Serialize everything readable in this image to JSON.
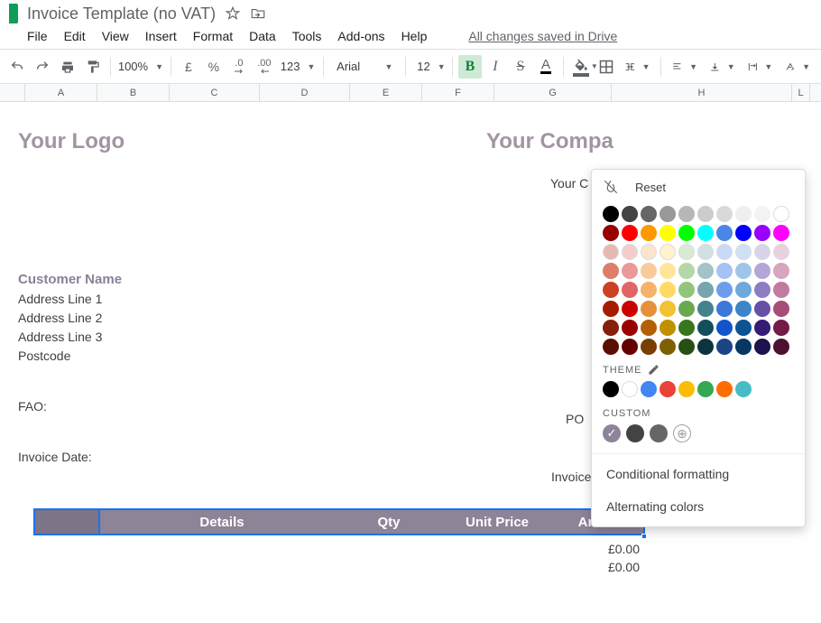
{
  "title": "Invoice Template (no VAT)",
  "menus": [
    "File",
    "Edit",
    "View",
    "Insert",
    "Format",
    "Data",
    "Tools",
    "Add-ons",
    "Help"
  ],
  "save_status": "All changes saved in Drive",
  "toolbar": {
    "zoom": "100%",
    "currency": "£",
    "percent": "%",
    "dec_decrease": ".0",
    "dec_increase": ".00",
    "more_formats": "123",
    "font": "Arial",
    "font_size": "12",
    "bold": "B",
    "italic": "I",
    "strike": "S",
    "text_color": "A"
  },
  "columns": [
    "",
    "A",
    "B",
    "C",
    "D",
    "E",
    "F",
    "G",
    "H",
    "L"
  ],
  "sheet": {
    "logo": "Your Logo",
    "company": "Your Compa",
    "your_c": "Your C",
    "customer": "Customer Name",
    "addr": [
      "Address Line 1",
      "Address Line 2",
      "Address Line 3",
      "Postcode"
    ],
    "fao": "FAO:",
    "po": "PO",
    "invoice_date": "Invoice Date:",
    "invoice_number": "Invoice Number:",
    "headers": [
      "",
      "Details",
      "Qty",
      "Unit Price",
      "Amount"
    ],
    "amounts": [
      "£0.00",
      "£0.00"
    ]
  },
  "picker": {
    "reset": "Reset",
    "theme_label": "THEME",
    "custom_label": "CUSTOM",
    "conditional": "Conditional formatting",
    "alternating": "Alternating colors",
    "standard_colors": [
      [
        "#000000",
        "#434343",
        "#666666",
        "#999999",
        "#b7b7b7",
        "#cccccc",
        "#d9d9d9",
        "#efefef",
        "#f3f3f3",
        "#ffffff"
      ],
      [
        "#980000",
        "#ff0000",
        "#ff9900",
        "#ffff00",
        "#00ff00",
        "#00ffff",
        "#4a86e8",
        "#0000ff",
        "#9900ff",
        "#ff00ff"
      ],
      [
        "#e6b8af",
        "#f4cccc",
        "#fce5cd",
        "#fff2cc",
        "#d9ead3",
        "#d0e0e3",
        "#c9daf8",
        "#cfe2f3",
        "#d9d2e9",
        "#ead1dc"
      ],
      [
        "#dd7e6b",
        "#ea9999",
        "#f9cb9c",
        "#ffe599",
        "#b6d7a8",
        "#a2c4c9",
        "#a4c2f4",
        "#9fc5e8",
        "#b4a7d6",
        "#d5a6bd"
      ],
      [
        "#cc4125",
        "#e06666",
        "#f6b26b",
        "#ffd966",
        "#93c47d",
        "#76a5af",
        "#6d9eeb",
        "#6fa8dc",
        "#8e7cc3",
        "#c27ba0"
      ],
      [
        "#a61c00",
        "#cc0000",
        "#e69138",
        "#f1c232",
        "#6aa84f",
        "#45818e",
        "#3c78d8",
        "#3d85c6",
        "#674ea7",
        "#a64d79"
      ],
      [
        "#85200c",
        "#990000",
        "#b45f06",
        "#bf9000",
        "#38761d",
        "#134f5c",
        "#1155cc",
        "#0b5394",
        "#351c75",
        "#741b47"
      ],
      [
        "#5b0f00",
        "#660000",
        "#783f04",
        "#7f6000",
        "#274e13",
        "#0c343d",
        "#1c4587",
        "#073763",
        "#20124d",
        "#4c1130"
      ]
    ],
    "theme_colors": [
      "#000000",
      "#ffffff",
      "#4285f4",
      "#ea4335",
      "#fbbc04",
      "#34a853",
      "#ff6d01",
      "#46bdc6"
    ],
    "custom_colors": [
      "#8e8498",
      "#434343",
      "#666666"
    ]
  }
}
